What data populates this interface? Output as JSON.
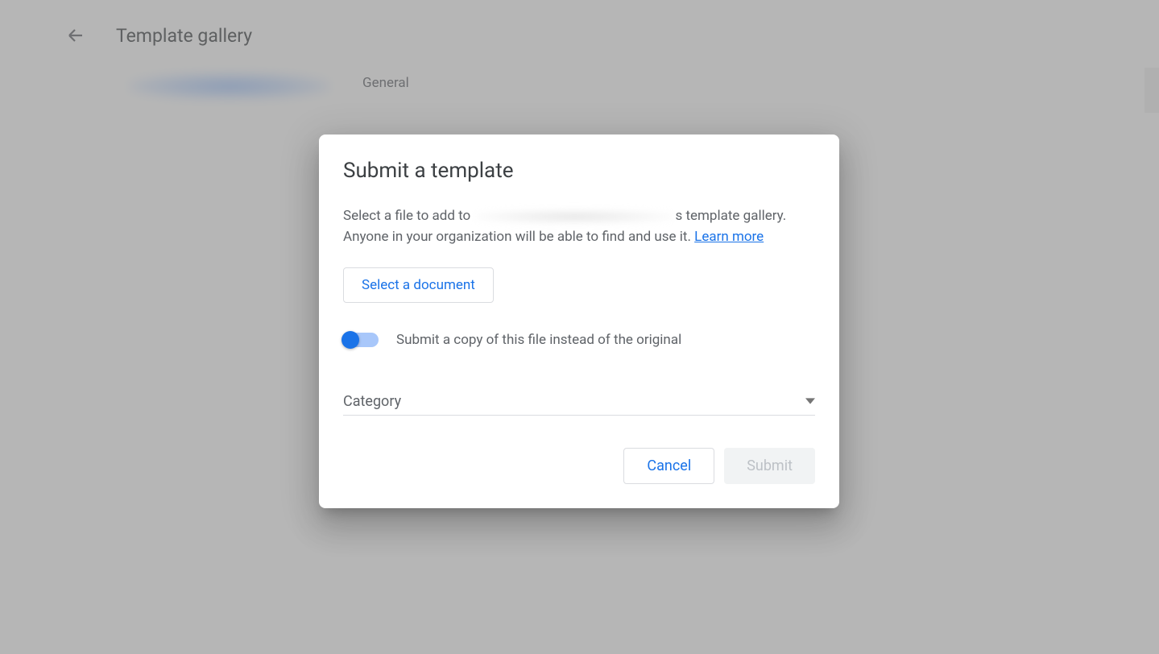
{
  "header": {
    "page_title": "Template gallery"
  },
  "tabs": {
    "general": "General"
  },
  "dialog": {
    "title": "Submit a template",
    "desc_prefix": "Select a file to add to",
    "desc_suffix": "s template gallery. Anyone in your organization will be able to find and use it.",
    "learn_more": "Learn more",
    "select_doc": "Select a document",
    "toggle_label": "Submit a copy of this file instead of the original",
    "category_label": "Category",
    "cancel": "Cancel",
    "submit": "Submit"
  }
}
